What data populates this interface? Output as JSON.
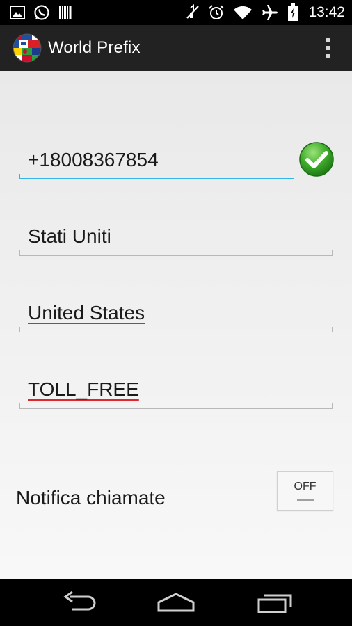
{
  "status_bar": {
    "time": "13:42",
    "left_icons": [
      "image-icon",
      "whatsapp-icon",
      "barcode-icon"
    ],
    "right_icons": [
      "mute-icon",
      "alarm-icon",
      "wifi-icon",
      "airplane-icon",
      "battery-icon"
    ]
  },
  "action_bar": {
    "title": "World Prefix",
    "overflow_icon": "overflow-menu-icon"
  },
  "form": {
    "phone_number": "+18008367854",
    "country_local": "Stati Uniti",
    "country_english": "United States",
    "number_type": "TOLL_FREE"
  },
  "notify": {
    "label": "Notifica chiamate",
    "toggle_state": "OFF"
  },
  "nav_bar": {
    "icons": [
      "back-icon",
      "home-icon",
      "recents-icon"
    ]
  },
  "colors": {
    "accent": "#33b5e5",
    "check_green": "#3fae2a",
    "spellcheck": "#e0262a",
    "action_bar": "#222222"
  }
}
